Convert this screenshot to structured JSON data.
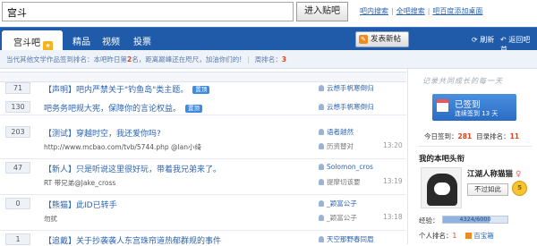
{
  "search": {
    "value": "宫斗",
    "button": "进入贴吧"
  },
  "top_links": [
    "吧内搜索",
    "全吧搜索",
    "吧百度添加桌面"
  ],
  "nav": {
    "active_tab": "宫斗吧",
    "tabs": [
      "精品",
      "视频",
      "投票"
    ],
    "post_button": "发表新帖",
    "refresh": "刷新",
    "back_to_bar": "返回吧首"
  },
  "notice": {
    "left": "当代其他文学作品签到排名：本吧昨日第",
    "rank": "2",
    "middle": "名，距离巅峰还在咫尺，加油你们的!",
    "weekly_label": "周排名：",
    "weekly_rank": "3"
  },
  "threads": [
    {
      "replies": "71",
      "title": "【声明】吧内严禁关于\"钓鱼岛\"类主题。",
      "badge": "置顶",
      "abstract": "",
      "author": "云想手帆寒倒归",
      "last_user": "",
      "time": ""
    },
    {
      "replies": "130",
      "title": "吧务务吧规大宪，保障你的言论权益。",
      "badge": "置顶",
      "abstract": "",
      "author": "云想手帆寒倒归",
      "last_user": "",
      "time": ""
    },
    {
      "replies": "203",
      "title": "【测试】穿越时空，我还爱你吗?",
      "badge": "",
      "abstract": "http://www.mcbao.com/tvb/5744.php @lan小绮",
      "author": "语者越然",
      "last_user": "历资替对",
      "time": "13:20"
    },
    {
      "replies": "47",
      "title": "【新人】只是听说这里很好玩，带着我兄弟来了。",
      "badge": "",
      "abstract": "RT 带兄弟@Jake_cross",
      "author": "Solomon_cros",
      "last_user": "提摩切该要",
      "time": "13:19"
    },
    {
      "replies": "0",
      "title": "【熊猫】此ID已转手",
      "badge": "",
      "abstract": "勿扰",
      "author": "_颖富公子",
      "last_user": "_颖富公子",
      "time": "13:18"
    },
    {
      "replies": "1",
      "title": "【追戴】关于抄袭袭人东宫珠帘道热郁群规的事件",
      "badge": "",
      "abstract": "",
      "author": "天空那野春同眉",
      "last_user": "",
      "time": ""
    }
  ],
  "sidebar": {
    "sign_heading": "记录共同成长的每一天",
    "signed": "已签到",
    "streak": "连续签到 13 天",
    "today_label": "今日签到：",
    "today_count": "281",
    "rank_label": "目录排名：",
    "rank_value": "11",
    "my_head": "我的本吧头衔",
    "username": "江湖人称猫猫",
    "unfollow": "不过如此",
    "level": "5",
    "exp_label": "经验：",
    "exp_text": "4324/6000",
    "exp_progress": 0.72,
    "personal_rank_label": "个人排名：",
    "personal_rank": "1",
    "box_label": "百宝箱"
  },
  "colors": {
    "nav": "#1f5ba8",
    "accent": "#e0401a",
    "link": "#2d64b3"
  }
}
